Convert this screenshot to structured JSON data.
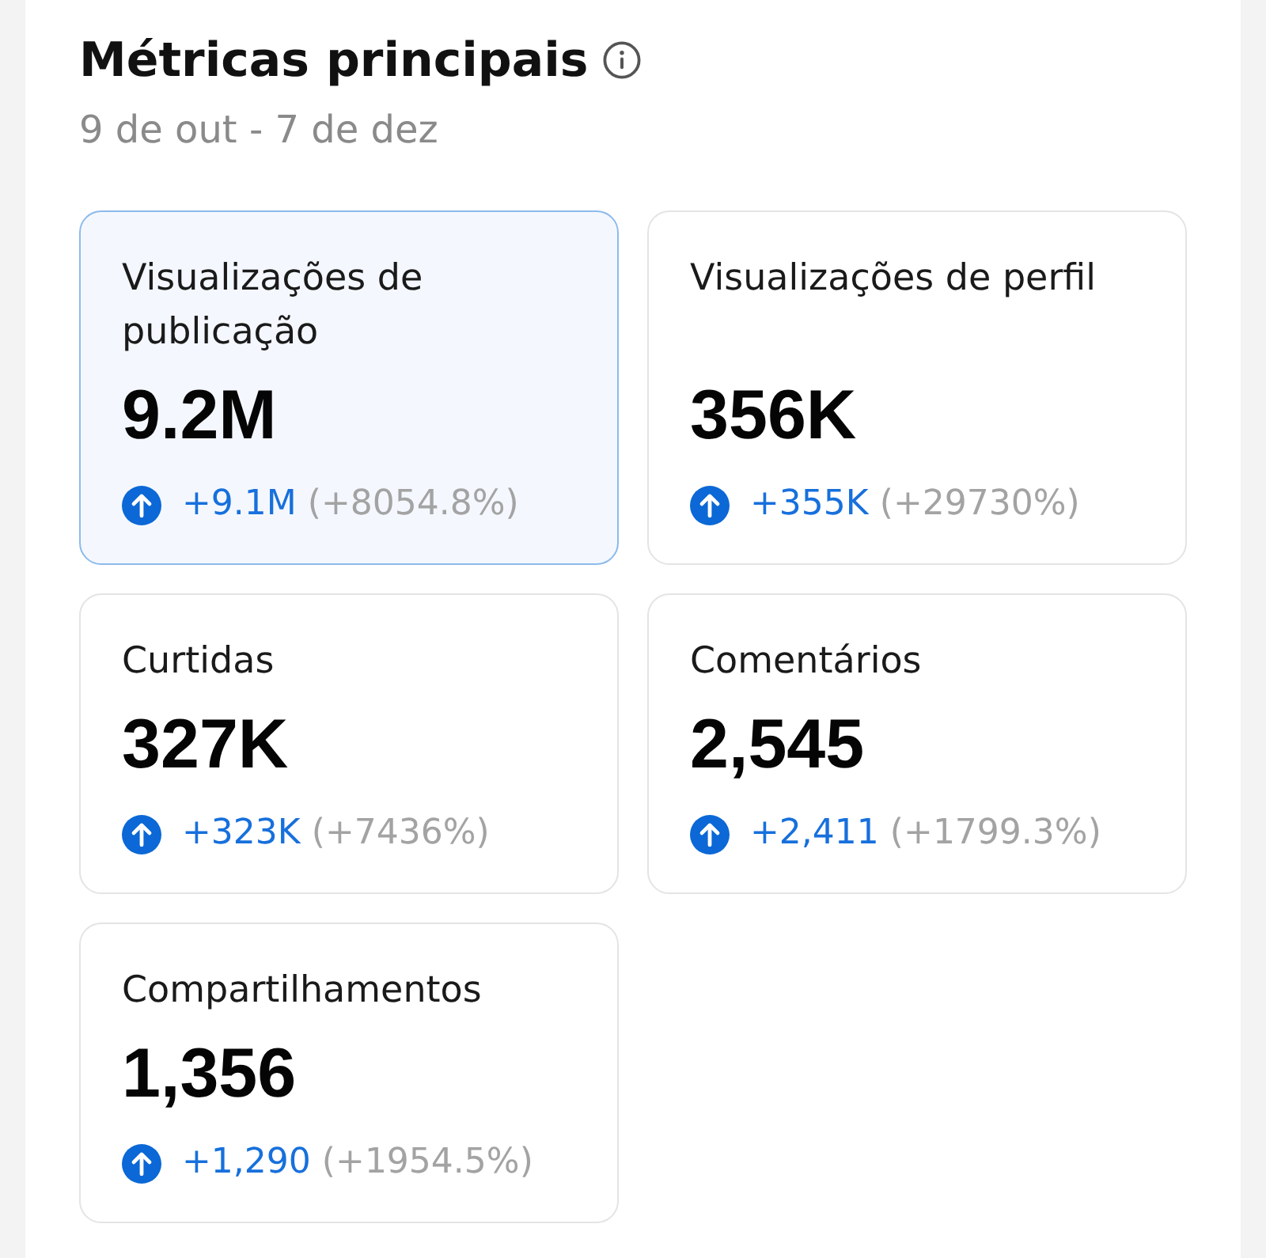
{
  "header": {
    "title": "Métricas principais",
    "subtitle": "9 de out - 7 de dez"
  },
  "metrics": [
    {
      "label": "Visualizações de publicação",
      "value": "9.2M",
      "change": "+9.1M",
      "change_percent": "(+8054.8%)",
      "increase": true,
      "selected": true
    },
    {
      "label": "Visualizações de perfil",
      "value": "356K",
      "change": "+355K",
      "change_percent": "(+29730%)",
      "increase": true,
      "selected": false
    },
    {
      "label": "Curtidas",
      "value": "327K",
      "change": "+323K",
      "change_percent": "(+7436%)",
      "increase": true,
      "selected": false
    },
    {
      "label": "Comentários",
      "value": "2,545",
      "change": "+2,411",
      "change_percent": "(+1799.3%)",
      "increase": true,
      "selected": false
    },
    {
      "label": "Compartilhamentos",
      "value": "1,356",
      "change": "+1,290",
      "change_percent": "(+1954.5%)",
      "increase": true,
      "selected": false
    }
  ]
}
